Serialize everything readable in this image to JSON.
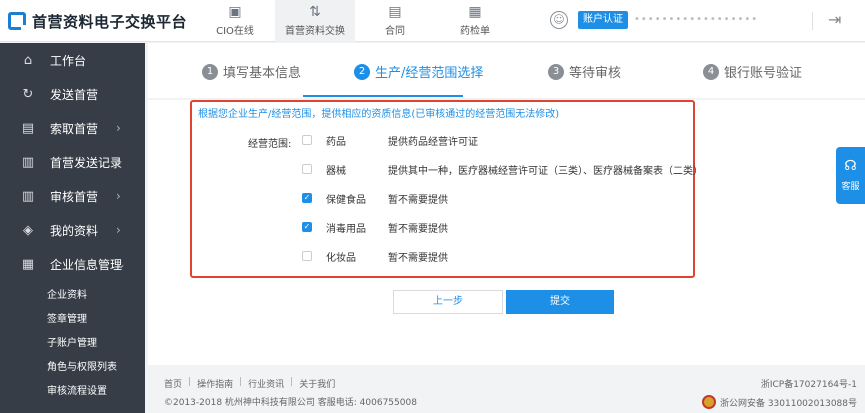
{
  "app": {
    "title": "首营资料电子交换平台",
    "account_badge": "账户认证",
    "account_name": "••••••••••••••••••"
  },
  "nav": [
    {
      "label": "CIO在线",
      "icon": "building-icon",
      "glyph": "▣"
    },
    {
      "label": "首营资料交换",
      "icon": "exchange-icon",
      "glyph": "⇅"
    },
    {
      "label": "合同",
      "icon": "contract-icon",
      "glyph": "▤"
    },
    {
      "label": "药检单",
      "icon": "report-icon",
      "glyph": "▦"
    }
  ],
  "sidebar": {
    "items": [
      {
        "label": "工作台",
        "icon": "home-icon",
        "glyph": "⌂",
        "arrow": ""
      },
      {
        "label": "发送首营",
        "icon": "send-icon",
        "glyph": "↻",
        "arrow": ""
      },
      {
        "label": "索取首营",
        "icon": "request-icon",
        "glyph": "▤",
        "arrow": "›"
      },
      {
        "label": "首营发送记录",
        "icon": "record-icon",
        "glyph": "▥",
        "arrow": "›"
      },
      {
        "label": "审核首营",
        "icon": "audit-icon",
        "glyph": "▥",
        "arrow": "›"
      },
      {
        "label": "我的资料",
        "icon": "layers-icon",
        "glyph": "◈",
        "arrow": "›"
      },
      {
        "label": "企业信息管理",
        "icon": "company-icon",
        "glyph": "▦",
        "arrow": "⌄"
      }
    ],
    "subitems": [
      "企业资料",
      "签章管理",
      "子账户管理",
      "角色与权限列表",
      "审核流程设置"
    ]
  },
  "steps": [
    {
      "num": "1",
      "label": "填写基本信息"
    },
    {
      "num": "2",
      "label": "生产/经营范围选择"
    },
    {
      "num": "3",
      "label": "等待审核"
    },
    {
      "num": "4",
      "label": "银行账号验证"
    }
  ],
  "form": {
    "notice": "根据您企业生产/经营范围，提供相应的资质信息(已审核通过的经营范围无法修改)",
    "scope_label": "经营范围:",
    "rows": [
      {
        "name": "药品",
        "requirement": "提供药品经营许可证",
        "checked": false
      },
      {
        "name": "器械",
        "requirement": "提供其中一种，医疗器械经营许可证（三类）、医疗器械备案表（二类）",
        "checked": false
      },
      {
        "name": "保健食品",
        "requirement": "暂不需要提供",
        "checked": true
      },
      {
        "name": "消毒用品",
        "requirement": "暂不需要提供",
        "checked": true
      },
      {
        "name": "化妆品",
        "requirement": "暂不需要提供",
        "checked": false
      }
    ],
    "prev_label": "上一步",
    "submit_label": "提交"
  },
  "footer": {
    "links": [
      "首页",
      "操作指南",
      "行业资讯",
      "关于我们"
    ],
    "copyright": "©2013-2018  杭州神中科技有限公司  客服电话: 4006755008",
    "icp": "浙ICP备17027164号-1",
    "police": "浙公网安备 33011002013088号"
  },
  "service": {
    "label": "客服"
  },
  "colors": {
    "accent": "#1e8fe6",
    "sidebar": "#363d47",
    "highlight_border": "#e0432f"
  }
}
